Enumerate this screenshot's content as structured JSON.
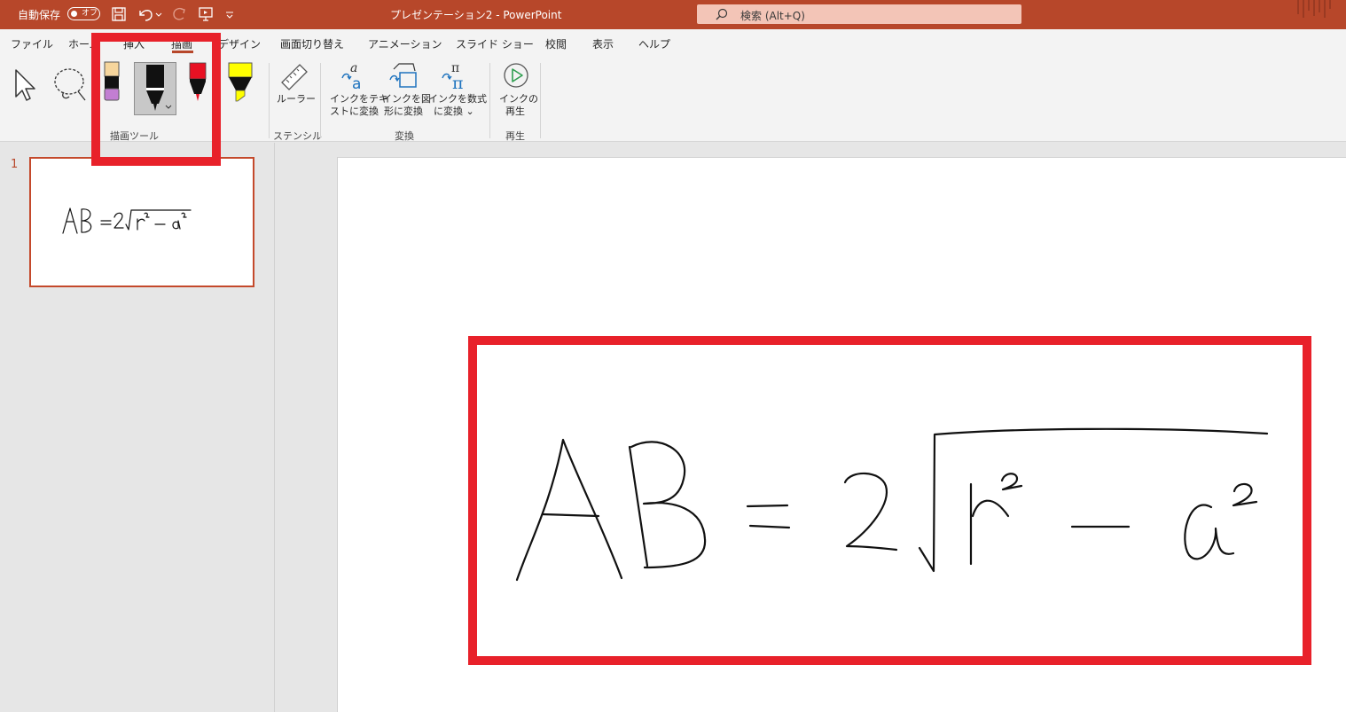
{
  "titlebar": {
    "autosave_label": "自動保存",
    "autosave_toggle": "オフ",
    "document_title": "プレゼンテーション2  -  PowerPoint",
    "search_placeholder": "検索 (Alt+Q)"
  },
  "tabs": [
    {
      "label": "ファイル"
    },
    {
      "label": "ホーム"
    },
    {
      "label": "挿入"
    },
    {
      "label": "描画",
      "active": true
    },
    {
      "label": "デザイン"
    },
    {
      "label": "画面切り替え"
    },
    {
      "label": "アニメーション"
    },
    {
      "label": "スライド ショー"
    },
    {
      "label": "校閲"
    },
    {
      "label": "表示"
    },
    {
      "label": "ヘルプ"
    }
  ],
  "ribbon": {
    "groups": {
      "draw_tools": "描画ツール",
      "stencil": "ステンシル",
      "convert": "変換",
      "replay": "再生"
    },
    "buttons": {
      "ruler": "ルーラー",
      "ink_to_text_1": "インクをテキ",
      "ink_to_text_2": "ストに変換",
      "ink_to_shape_1": "インクを図",
      "ink_to_shape_2": "形に変換",
      "ink_to_math_1": "インクを数式",
      "ink_to_math_2": "に変換 ⌄",
      "ink_replay_1": "インクの",
      "ink_replay_2": "再生"
    },
    "pens": [
      {
        "name": "pencil-pen",
        "color": "#c27ed2"
      },
      {
        "name": "black-pen",
        "color": "#000000",
        "selected": true
      },
      {
        "name": "red-pen",
        "color": "#e81123"
      },
      {
        "name": "yellow-highlighter",
        "color": "#ffff00"
      }
    ]
  },
  "thumbnails": [
    {
      "number": "1",
      "content": "AB = 2√r² − a²"
    }
  ],
  "slide": {
    "ink_equation": "AB = 2√r² − a²"
  },
  "colors": {
    "accent": "#b7472a",
    "highlight": "#e8212a"
  }
}
